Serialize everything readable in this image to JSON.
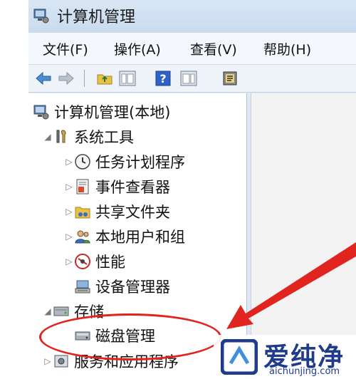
{
  "window": {
    "title": "计算机管理"
  },
  "menu": [
    "文件(F)",
    "操作(A)",
    "查看(V)",
    "帮助(H)"
  ],
  "tree": {
    "root": "计算机管理(本地)",
    "system_tools": "系统工具",
    "task_scheduler": "任务计划程序",
    "event_viewer": "事件查看器",
    "shared_folders": "共享文件夹",
    "local_users": "本地用户和组",
    "performance": "性能",
    "device_manager": "设备管理器",
    "storage": "存储",
    "disk_management": "磁盘管理",
    "services": "服务和应用程序"
  },
  "watermark": {
    "brand": "爱纯净",
    "url": "aichunjing.com"
  },
  "colors": {
    "highlight": "#e2241f",
    "brand": "#1f3b8a"
  }
}
